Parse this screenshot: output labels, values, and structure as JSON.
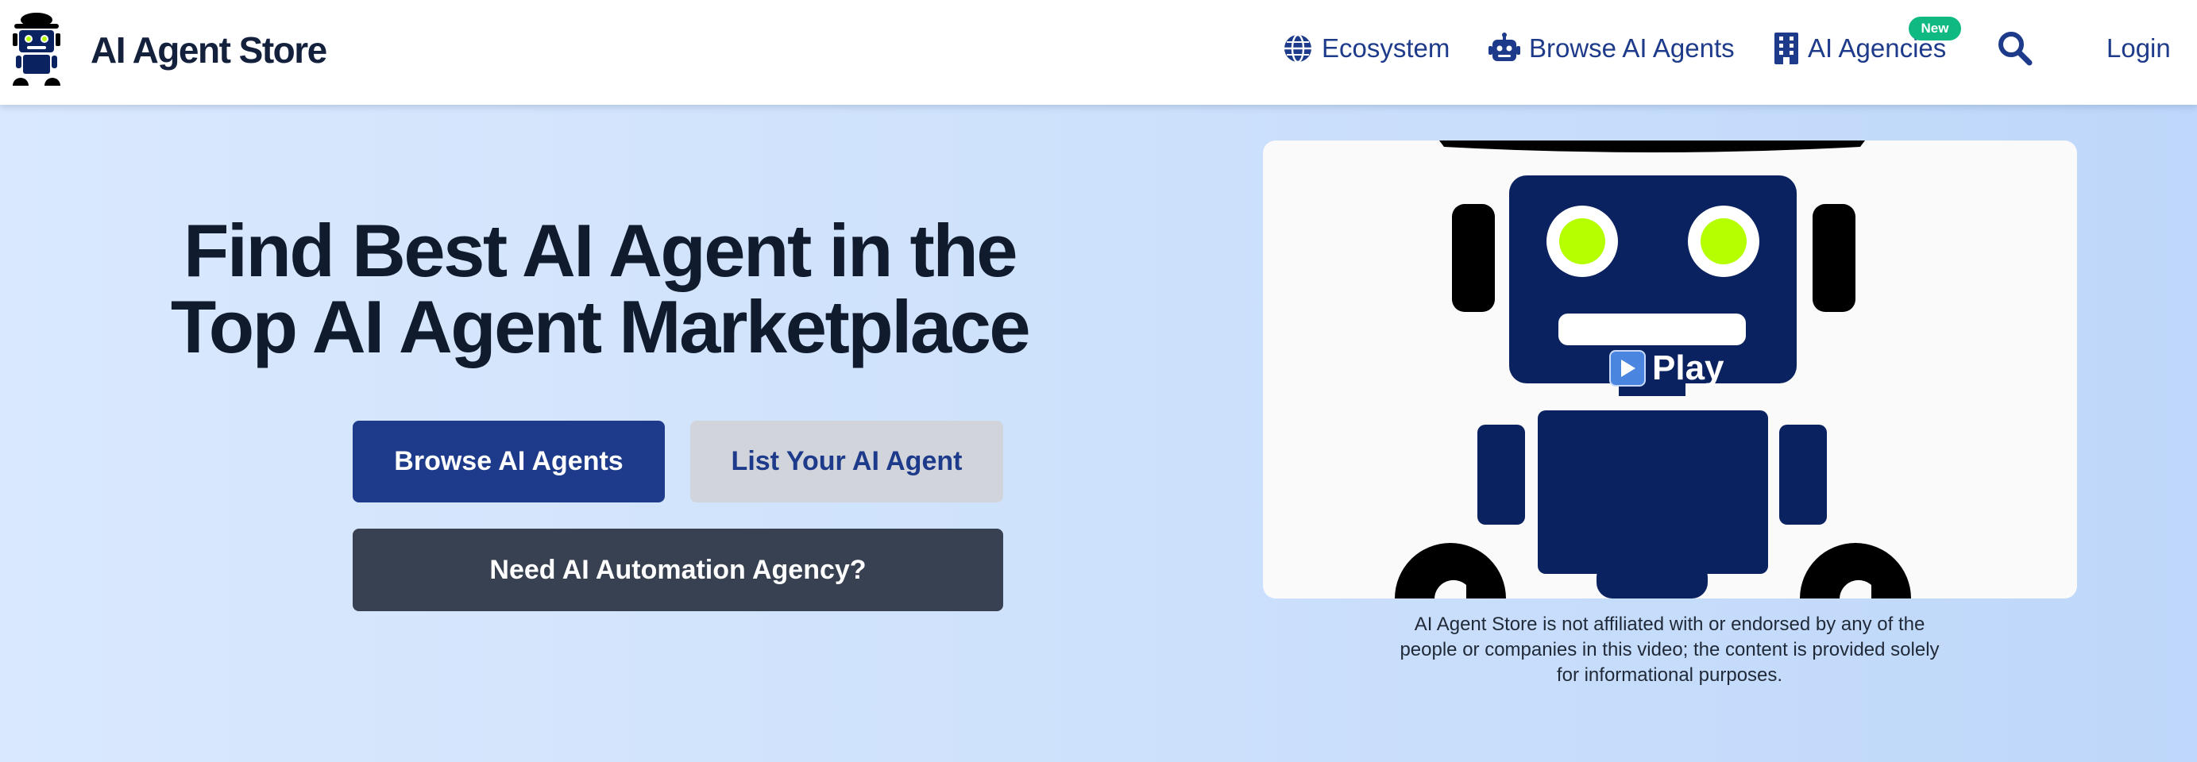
{
  "header": {
    "brand_title": "AI Agent Store",
    "nav": {
      "ecosystem": "Ecosystem",
      "browse": "Browse AI Agents",
      "agencies": "AI Agencies",
      "agencies_badge": "New"
    },
    "login": "Login"
  },
  "hero": {
    "title_line1": "Find Best AI Agent in the",
    "title_line2": "Top AI Agent Marketplace",
    "buttons": {
      "browse": "Browse AI Agents",
      "list": "List Your AI Agent",
      "agency": "Need AI Automation Agency?"
    }
  },
  "video": {
    "play_label": "Play",
    "disclaimer": "AI Agent Store is not affiliated with or endorsed by any of the people or companies in this video; the content is provided solely for informational purposes."
  },
  "colors": {
    "brand_navy": "#1e3a8a",
    "title_dark": "#101b2e",
    "badge_green": "#10b981",
    "robot_navy": "#0b2260",
    "robot_eye": "#b5ff00",
    "secondary_button": "#d1d5db",
    "agency_button": "#374151"
  },
  "icons": {
    "logo": "robot-logo-icon",
    "ecosystem": "globe-icon",
    "browse": "robot-icon",
    "agencies": "building-icon",
    "search": "search-icon",
    "play": "play-icon"
  }
}
